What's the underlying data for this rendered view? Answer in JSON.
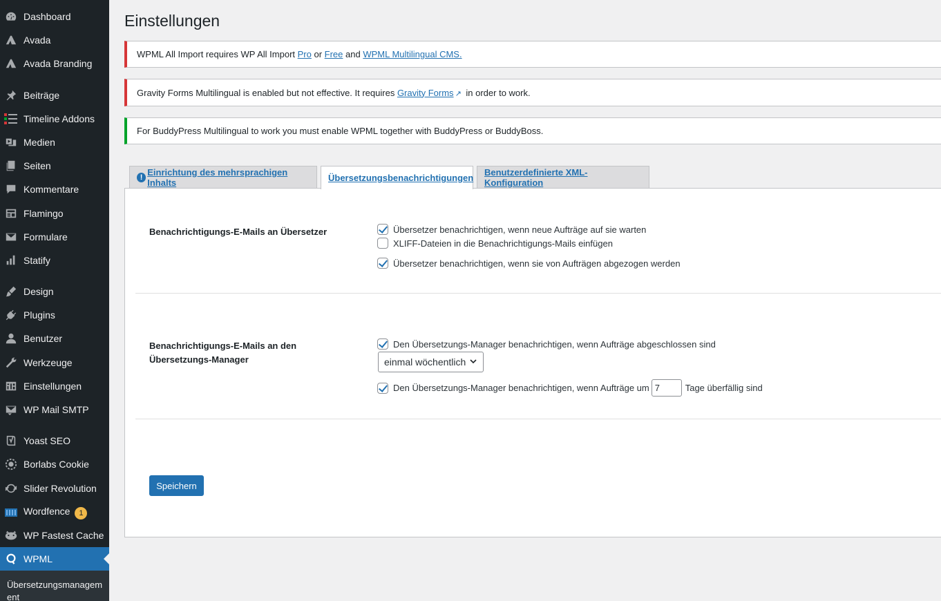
{
  "sidebar": {
    "items": [
      {
        "label": "Dashboard",
        "icon": "dashboard-icon"
      },
      {
        "label": "Avada",
        "icon": "avada-icon"
      },
      {
        "label": "Avada Branding",
        "icon": "avada-branding-icon"
      },
      {
        "label": "Beiträge",
        "icon": "pin-icon"
      },
      {
        "label": "Timeline Addons",
        "icon": "timeline-icon"
      },
      {
        "label": "Medien",
        "icon": "media-icon"
      },
      {
        "label": "Seiten",
        "icon": "pages-icon"
      },
      {
        "label": "Kommentare",
        "icon": "comment-icon"
      },
      {
        "label": "Flamingo",
        "icon": "flamingo-icon"
      },
      {
        "label": "Formulare",
        "icon": "mail-icon"
      },
      {
        "label": "Statify",
        "icon": "bar-chart-icon"
      },
      {
        "label": "Design",
        "icon": "brush-icon"
      },
      {
        "label": "Plugins",
        "icon": "plug-icon"
      },
      {
        "label": "Benutzer",
        "icon": "user-icon"
      },
      {
        "label": "Werkzeuge",
        "icon": "wrench-icon"
      },
      {
        "label": "Einstellungen",
        "icon": "settings-icon"
      },
      {
        "label": "WP Mail SMTP",
        "icon": "smtp-icon"
      },
      {
        "label": "Yoast SEO",
        "icon": "yoast-icon"
      },
      {
        "label": "Borlabs Cookie",
        "icon": "cookie-icon"
      },
      {
        "label": "Slider Revolution",
        "icon": "refresh-icon"
      },
      {
        "label": "Wordfence",
        "icon": "wordfence-icon",
        "badge": "1"
      },
      {
        "label": "WP Fastest Cache",
        "icon": "cheetah-icon"
      },
      {
        "label": "WPML",
        "icon": "wpml-icon",
        "active": true
      }
    ],
    "submenu_label": "Übersetzungsmanagement"
  },
  "page": {
    "title": "Einstellungen"
  },
  "notices": {
    "n1": {
      "text_before": "WPML All Import requires WP All Import ",
      "link_pro": "Pro",
      "text_or": " or ",
      "link_free": "Free",
      "text_and": " and ",
      "link_wpml": "WPML Multilingual CMS."
    },
    "n2": {
      "text_before": "Gravity Forms Multilingual is enabled but not effective. It requires ",
      "link": "Gravity Forms",
      "text_after": " in order to work."
    },
    "n3": {
      "text": "For BuddyPress Multilingual to work you must enable WPML together with BuddyPress or BuddyBoss."
    }
  },
  "tabs": {
    "t1": "Einrichtung des mehrsprachigen Inhalts",
    "t2": "Übersetzungsbenachrichtigungen",
    "t3": "Benutzerdefinierte XML-Konfiguration"
  },
  "section1": {
    "label": "Benachrichtigungs-E-Mails an Übersetzer",
    "opt1": "Übersetzer benachrichtigen, wenn neue Aufträge auf sie warten",
    "opt1_checked": true,
    "opt2": "XLIFF-Dateien in die Benachrichtigungs-Mails einfügen",
    "opt2_checked": false,
    "opt3": "Übersetzer benachrichtigen, wenn sie von Aufträgen abgezogen werden",
    "opt3_checked": true
  },
  "section2": {
    "label": "Benachrichtigungs-E-Mails an den Übersetzungs-Manager",
    "opt1": "Den Übersetzungs-Manager benachrichtigen, wenn Aufträge abgeschlossen sind",
    "opt1_checked": true,
    "frequency": "einmal wöchentlich",
    "opt2_before": "Den Übersetzungs-Manager benachrichtigen, wenn Aufträge um",
    "opt2_days": "7",
    "opt2_after": "Tage überfällig sind",
    "opt2_checked": true
  },
  "save_label": "Speichern",
  "colors": {
    "sidebar_bg": "#1d2327",
    "accent": "#2271b1",
    "error": "#d63638",
    "success": "#00a32a",
    "badge": "#f0b849"
  }
}
